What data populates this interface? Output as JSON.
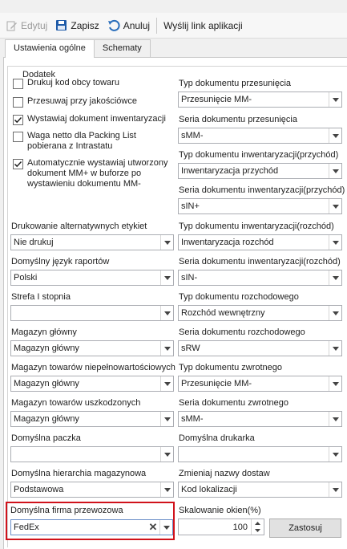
{
  "toolbar": {
    "edit_label": "Edytuj",
    "save_label": "Zapisz",
    "cancel_label": "Anuluj",
    "send_link_label": "Wyślij link aplikacji"
  },
  "tabs": [
    "Ustawienia ogólne",
    "Schematy"
  ],
  "group_title": "Dodatek",
  "checkboxes": [
    {
      "label": "Drukuj kod obcy towaru",
      "checked": false
    },
    {
      "label": "Przesuwaj przy jakościówce",
      "checked": false
    },
    {
      "label": "Wystawiaj dokument inwentaryzacji",
      "checked": true
    },
    {
      "label": "Waga netto dla Packing List pobierana z Intrastatu",
      "checked": false
    },
    {
      "label": "Automatycznie wystawiaj utworzony dokument MM+ w buforze po wystawieniu dokumentu MM-",
      "checked": true
    }
  ],
  "left_fields": [
    {
      "label": "Drukowanie alternatywnych etykiet",
      "value": "Nie drukuj"
    },
    {
      "label": "Domyślny język raportów",
      "value": "Polski"
    },
    {
      "label": "Strefa I stopnia",
      "value": ""
    },
    {
      "label": "Magazyn główny",
      "value": "Magazyn główny"
    },
    {
      "label": "Magazyn towarów niepełnowartościowych",
      "value": "Magazyn główny"
    },
    {
      "label": "Magazyn towarów uszkodzonych",
      "value": "Magazyn główny"
    },
    {
      "label": "Domyślna paczka",
      "value": ""
    },
    {
      "label": "Domyślna hierarchia magazynowa",
      "value": "Podstawowa"
    }
  ],
  "right_fields": [
    {
      "label": "Typ dokumentu przesunięcia",
      "value": "Przesunięcie MM-"
    },
    {
      "label": "Seria dokumentu przesunięcia",
      "value": "sMM-"
    },
    {
      "label": "Typ dokumentu inwentaryzacji(przychód)",
      "value": "Inwentaryzacja przychód"
    },
    {
      "label": "Seria dokumentu inwentaryzacji(przychód)",
      "value": "sIN+"
    },
    {
      "label": "Typ dokumentu inwentaryzacji(rozchód)",
      "value": "Inwentaryzacja rozchód"
    },
    {
      "label": "Seria dokumentu inwentaryzacji(rozchód)",
      "value": "sIN-"
    },
    {
      "label": "Typ dokumentu rozchodowego",
      "value": "Rozchód wewnętrzny"
    },
    {
      "label": "Seria dokumentu rozchodowego",
      "value": "sRW"
    },
    {
      "label": "Typ dokumentu zwrotnego",
      "value": "Przesunięcie MM-"
    },
    {
      "label": "Seria dokumentu zwrotnego",
      "value": "sMM-"
    },
    {
      "label": "Domyślna drukarka",
      "value": ""
    },
    {
      "label": "Zmieniaj nazwy dostaw",
      "value": "Kod lokalizacji"
    }
  ],
  "carrier": {
    "label": "Domyślna firma przewozowa",
    "value": "FedEx"
  },
  "scaling": {
    "label": "Skalowanie okien(%)",
    "value": "100",
    "apply_label": "Zastosuj"
  },
  "colors": {
    "highlight": "#d0121b",
    "save_icon": "#1e5aa8",
    "cancel_icon": "#2a6ebb"
  }
}
